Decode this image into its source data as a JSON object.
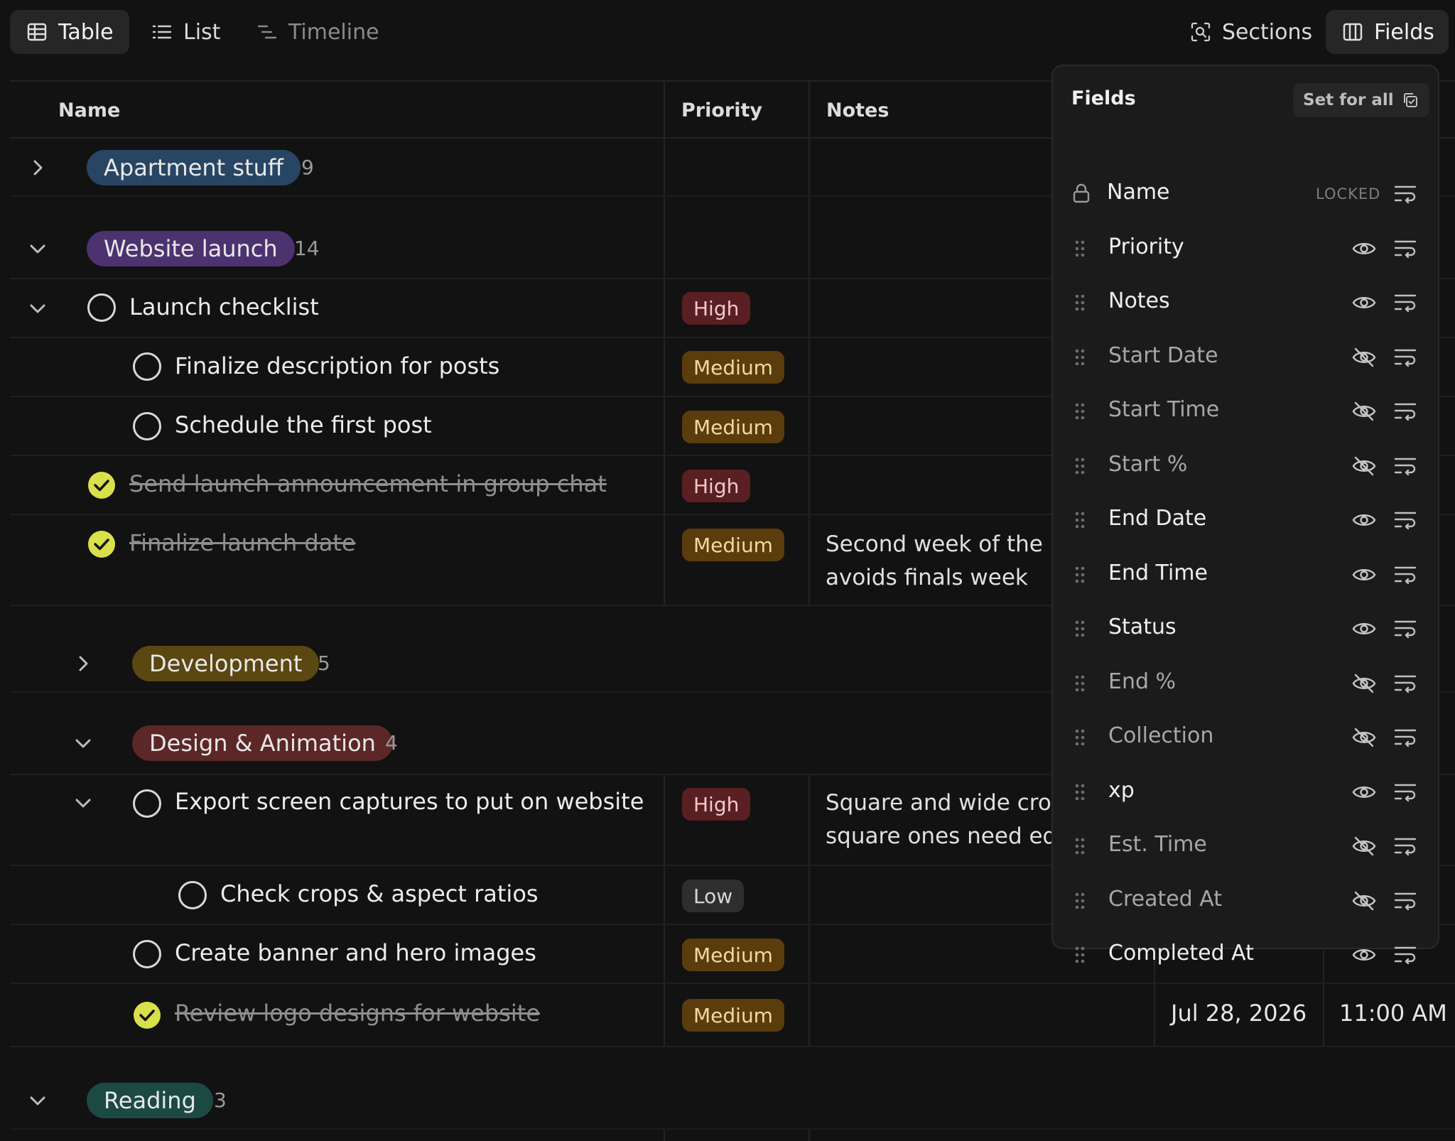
{
  "view_tabs": [
    {
      "label": "Table",
      "icon": "table-icon",
      "active": true
    },
    {
      "label": "List",
      "icon": "list-icon",
      "active": false
    },
    {
      "label": "Timeline",
      "icon": "timeline-icon",
      "active": false
    }
  ],
  "toolbar": {
    "sections_label": "Sections",
    "fields_label": "Fields"
  },
  "table": {
    "columns": {
      "name": "Name",
      "priority": "Priority",
      "notes": "Notes"
    },
    "groups": {
      "apartment": {
        "label": "Apartment stuff",
        "count": "9",
        "color": "#284663"
      },
      "website": {
        "label": "Website launch",
        "count": "14",
        "color": "#4d3270"
      },
      "development": {
        "label": "Development",
        "count": "5",
        "color": "#5a4711"
      },
      "design": {
        "label": "Design & Animation",
        "count": "4",
        "color": "#5c2727"
      },
      "reading": {
        "label": "Reading",
        "count": "3",
        "color": "#1c4a42"
      }
    },
    "tasks": {
      "launch_checklist": {
        "name": "Launch checklist",
        "priority": "High"
      },
      "finalize_description": {
        "name": "Finalize description for posts",
        "priority": "Medium"
      },
      "schedule_first_post": {
        "name": "Schedule the first post",
        "priority": "Medium"
      },
      "send_announcement": {
        "name": "Send launch announcement in group chat",
        "priority": "High"
      },
      "finalize_launch_date": {
        "name": "Finalize launch date",
        "priority": "Medium",
        "note_line1": "Second week of the n",
        "note_line2": "avoids finals week"
      },
      "export_captures": {
        "name": "Export screen captures to put on website",
        "priority": "High",
        "note_line1": "Square and wide crop",
        "note_line2": "square ones need edi"
      },
      "check_crops": {
        "name": "Check crops & aspect ratios",
        "priority": "Low"
      },
      "create_banner": {
        "name": "Create banner and hero images",
        "priority": "Medium"
      },
      "review_logo": {
        "name": "Review logo designs for website",
        "priority": "Medium",
        "end_date": "Jul 28, 2026",
        "end_time": "11:00 AM"
      }
    }
  },
  "fields_panel": {
    "title": "Fields",
    "set_for_all": "Set for all",
    "locked_label": "LOCKED",
    "fields": [
      {
        "label": "Name",
        "locked": true
      },
      {
        "label": "Priority",
        "visible": true
      },
      {
        "label": "Notes",
        "visible": true
      },
      {
        "label": "Start Date",
        "visible": false
      },
      {
        "label": "Start Time",
        "visible": false
      },
      {
        "label": "Start %",
        "visible": false
      },
      {
        "label": "End Date",
        "visible": true
      },
      {
        "label": "End Time",
        "visible": true
      },
      {
        "label": "Status",
        "visible": true
      },
      {
        "label": "End %",
        "visible": false
      },
      {
        "label": "Collection",
        "visible": false
      },
      {
        "label": "xp",
        "visible": true
      },
      {
        "label": "Est. Time",
        "visible": false
      },
      {
        "label": "Created At",
        "visible": false
      },
      {
        "label": "Completed At",
        "visible": true
      }
    ]
  }
}
